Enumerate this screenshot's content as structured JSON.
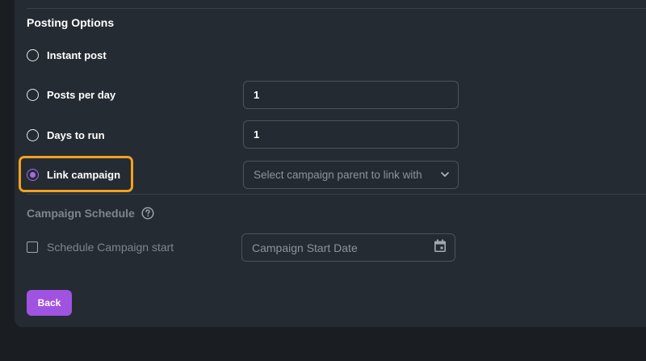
{
  "posting_options": {
    "title": "Posting Options",
    "options": [
      {
        "label": "Instant post",
        "checked": false
      },
      {
        "label": "Posts per day",
        "checked": false,
        "value": "1"
      },
      {
        "label": "Days to run",
        "checked": false,
        "value": "1"
      },
      {
        "label": "Link campaign",
        "checked": true,
        "placeholder": "Select campaign parent to link with"
      }
    ]
  },
  "campaign_schedule": {
    "title": "Campaign Schedule",
    "checkbox_label": "Schedule Campaign start",
    "date_placeholder": "Campaign Start Date"
  },
  "actions": {
    "back_label": "Back"
  },
  "colors": {
    "accent": "#a052e0",
    "highlight": "#f5a01e"
  },
  "icons": {
    "help": "question-circle-icon",
    "dropdown": "chevron-down-icon",
    "calendar": "calendar-icon"
  }
}
